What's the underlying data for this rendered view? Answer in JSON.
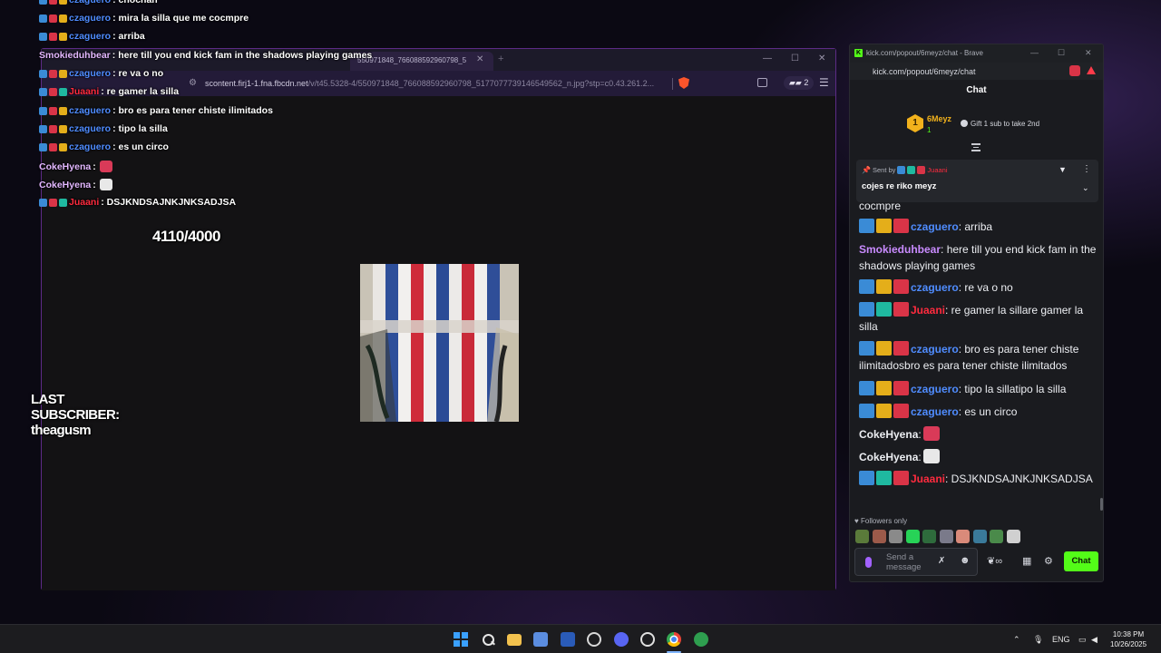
{
  "overlay": {
    "chat_lines": [
      {
        "user": "czaguero",
        "text": ": chochan",
        "color": "blue",
        "badges": [
          "blue",
          "red",
          "gold"
        ]
      },
      {
        "user": "czaguero",
        "text": ": mira la silla que me cocmpre",
        "color": "blue",
        "badges": [
          "blue",
          "red",
          "gold"
        ]
      },
      {
        "user": "czaguero",
        "text": ": arriba",
        "color": "blue",
        "badges": [
          "blue",
          "red",
          "gold"
        ]
      },
      {
        "user": "Smokieduhbear",
        "text": ": here till you end kick fam in the shadows playing games",
        "color": "pink",
        "badges": []
      },
      {
        "user": "czaguero",
        "text": ": re va o no",
        "color": "blue",
        "badges": [
          "blue",
          "red",
          "gold"
        ]
      },
      {
        "user": "Juaani",
        "text": ": re gamer la silla",
        "color": "red",
        "badges": [
          "blue",
          "red",
          "green"
        ]
      },
      {
        "user": "czaguero",
        "text": ": bro es para tener chiste ilimitados",
        "color": "blue",
        "badges": [
          "blue",
          "red",
          "gold"
        ]
      },
      {
        "user": "czaguero",
        "text": ": tipo la silla",
        "color": "blue",
        "badges": [
          "blue",
          "red",
          "gold"
        ]
      },
      {
        "user": "czaguero",
        "text": ": es un circo",
        "color": "blue",
        "badges": [
          "blue",
          "red",
          "gold"
        ]
      },
      {
        "user": "CokeHyena",
        "text": " :",
        "color": "pink",
        "badges": []
      },
      {
        "user": "CokeHyena",
        "text": " :",
        "color": "pink",
        "badges": []
      },
      {
        "user": "Juaani",
        "text": ": DSJKNDSAJNKJNKSADJSA",
        "color": "red",
        "badges": [
          "blue",
          "red",
          "green"
        ]
      }
    ],
    "counter": "4110/4000",
    "last_subscriber": "LAST SUBSCRIBER: theagusm"
  },
  "browser": {
    "tab_title": "550971848_766088592960798_5",
    "url_host": "scontent.firj1-1.fna.fbcdn.net",
    "url_path": "/v/t45.5328-4/550971848_766088592960798_5177077739146549562_n.jpg?stp=c0.43.261.2...",
    "wallet_count": "2"
  },
  "kick": {
    "window_title": "kick.com/popout/6meyz/chat - Brave",
    "url": "kick.com/popout/6meyz/chat",
    "header": "Chat",
    "leader": {
      "rank": "1",
      "name": "6Meyz",
      "count": "1"
    },
    "gift_text": "Gift 1 sub to take 2nd",
    "pinned": {
      "sent_by": "Sent by",
      "user": "Juaani",
      "message": "cojes re riko meyz"
    },
    "followers_only": "Followers only",
    "send_placeholder": "Send a\nmessage",
    "chat_button": "Chat",
    "messages": [
      {
        "user": "",
        "text": "cocmpre",
        "color": "white",
        "badges": []
      },
      {
        "user": "czaguero",
        "text": ": arriba",
        "color": "blue",
        "badges": [
          "blue",
          "gold",
          "red"
        ]
      },
      {
        "user": "Smokieduhbear",
        "text": ": here till you end kick fam in the shadows playing games",
        "color": "pink",
        "badges": []
      },
      {
        "user": "czaguero",
        "text": ": re va o no",
        "color": "blue",
        "badges": [
          "blue",
          "gold",
          "red"
        ]
      },
      {
        "user": "Juaani",
        "text": ": re gamer la sillare gamer la silla",
        "color": "red",
        "badges": [
          "blue",
          "green",
          "red"
        ]
      },
      {
        "user": "czaguero",
        "text": ": bro es para tener chiste ilimitadosbro es para tener chiste ilimitados",
        "color": "blue",
        "badges": [
          "blue",
          "gold",
          "red"
        ]
      },
      {
        "user": "czaguero",
        "text": ": tipo la sillatipo la silla",
        "color": "blue",
        "badges": [
          "blue",
          "gold",
          "red"
        ]
      },
      {
        "user": "czaguero",
        "text": ": es un circo",
        "color": "blue",
        "badges": [
          "blue",
          "gold",
          "red"
        ]
      },
      {
        "user": "CokeHyena",
        "text": ":",
        "color": "white",
        "badges": []
      },
      {
        "user": "CokeHyena",
        "text": ":",
        "color": "white",
        "badges": []
      },
      {
        "user": "Juaani",
        "text": ": DSJKNDSAJNKJNKSADJSA",
        "color": "red",
        "badges": [
          "blue",
          "green",
          "red"
        ]
      }
    ]
  },
  "taskbar": {
    "language": "ENG",
    "time": "10:38 PM",
    "date": "10/26/2025"
  },
  "colors": {
    "kick_green": "#53fc18",
    "user_blue": "#4f8cff",
    "user_red": "#ff2b3e",
    "window_border": "#5d2b86"
  }
}
